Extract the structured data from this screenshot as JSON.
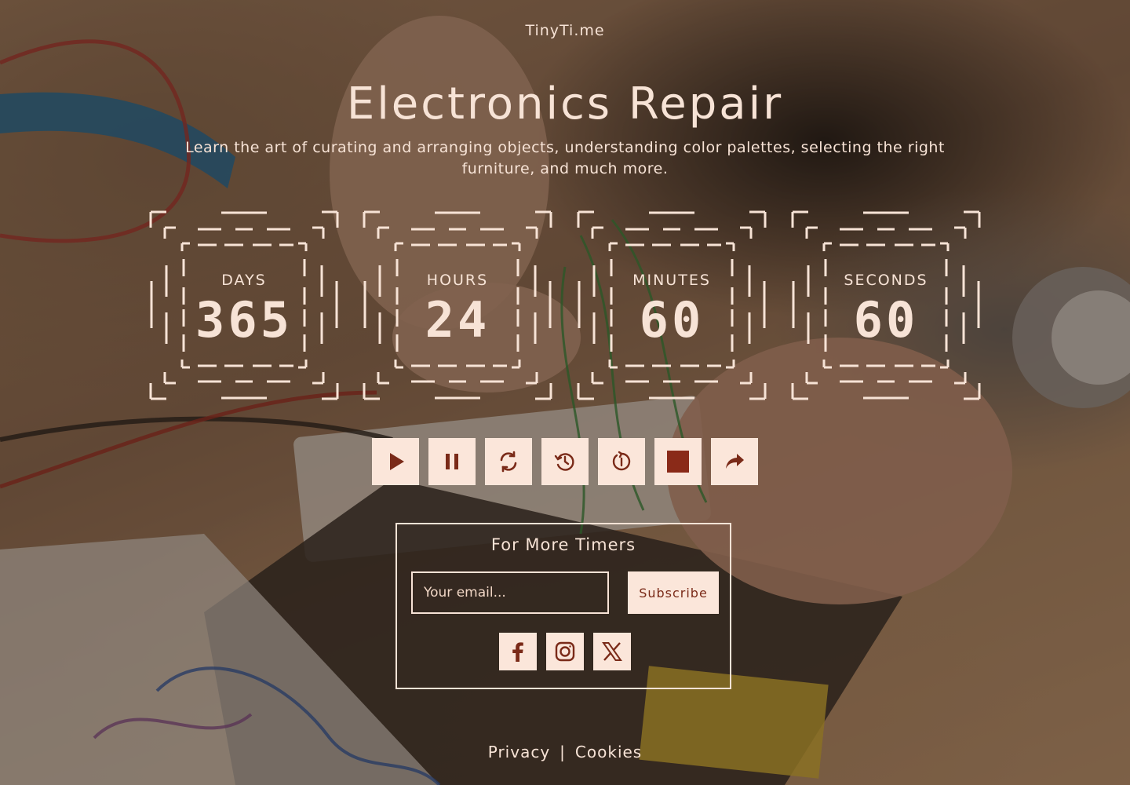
{
  "brand": "TinyTi.me",
  "title": "Electronics Repair",
  "subtitle": "Learn the art of curating and arranging objects, understanding color palettes, selecting the right furniture, and much more.",
  "timers": [
    {
      "label": "DAYS",
      "value": "365"
    },
    {
      "label": "HOURS",
      "value": "24"
    },
    {
      "label": "MINUTES",
      "value": "60"
    },
    {
      "label": "SECONDS",
      "value": "60"
    }
  ],
  "controls": [
    {
      "icon": "play-icon"
    },
    {
      "icon": "pause-icon"
    },
    {
      "icon": "refresh-icon"
    },
    {
      "icon": "history-back-icon"
    },
    {
      "icon": "history-forward-icon"
    },
    {
      "icon": "stop-icon"
    },
    {
      "icon": "share-icon"
    }
  ],
  "subscribe": {
    "title": "For More Timers",
    "placeholder": "Your email...",
    "button": "Subscribe"
  },
  "socials": [
    "facebook-icon",
    "instagram-icon",
    "x-icon"
  ],
  "footer": {
    "privacy": "Privacy",
    "separator": "|",
    "cookies": "Cookies"
  },
  "colors": {
    "text": "#f7e3d6",
    "button_bg": "#fbe6da",
    "icon": "#7a2a18"
  }
}
